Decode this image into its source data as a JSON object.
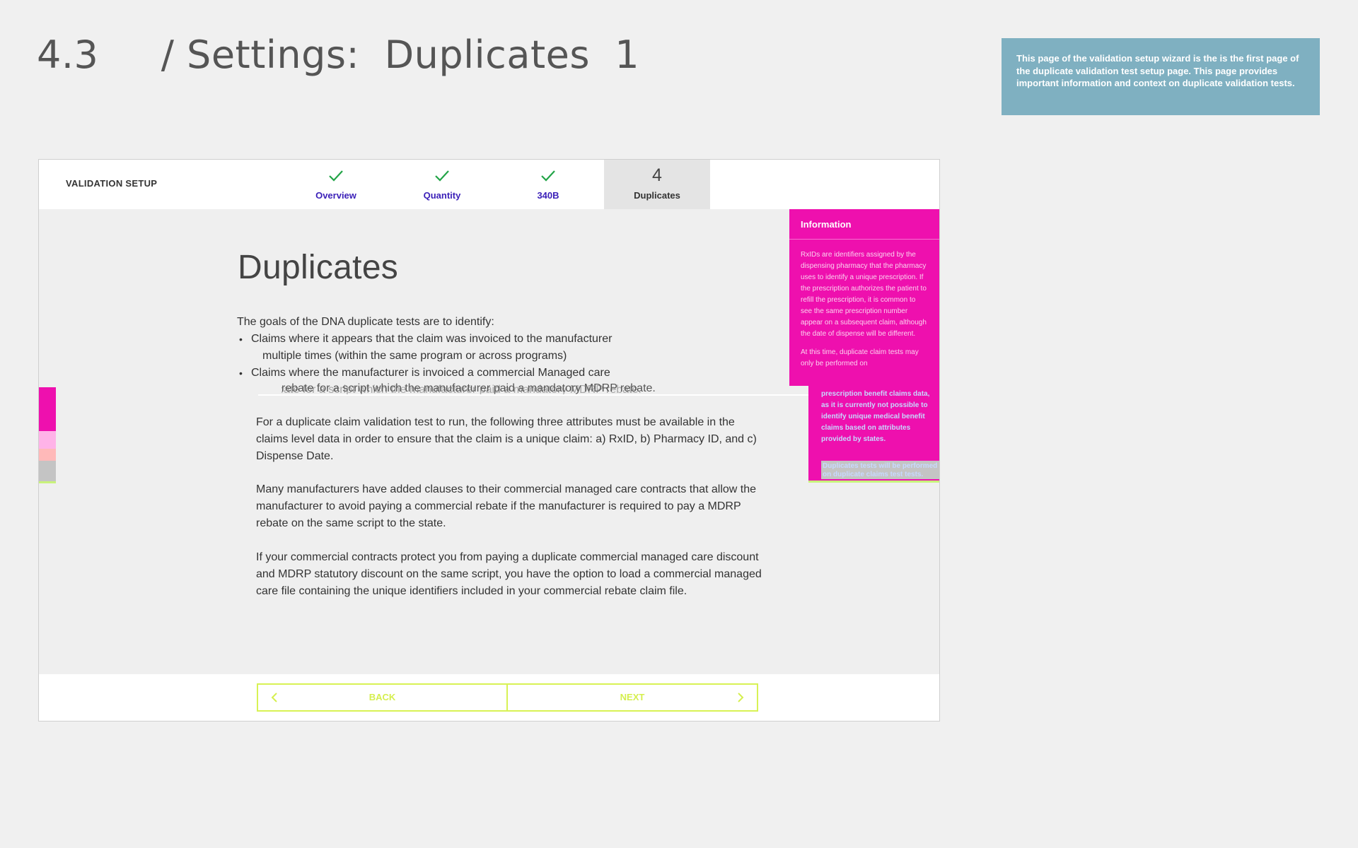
{
  "slide": {
    "title": "4.3     / Settings:  Duplicates  1",
    "note": "This page of the validation setup wizard is the is the first page of the duplicate validation test setup page. This page provides important information and context on duplicate validation  tests."
  },
  "app": {
    "brand": "VALIDATION SETUP",
    "steps": [
      {
        "label": "Overview",
        "state": "done"
      },
      {
        "label": "Quantity",
        "state": "done"
      },
      {
        "label": "340B",
        "state": "done"
      },
      {
        "number": "4",
        "label": "Duplicates",
        "state": "active"
      }
    ],
    "check_color": "#22a447",
    "accent": "#3a1fb8"
  },
  "content": {
    "title": "Duplicates",
    "goals_intro": "The goals of the DNA duplicate tests are to identify:",
    "bullets": [
      {
        "line1": "Claims where it appears that the claim was invoiced to the manufacturer",
        "line2": "multiple times (within the same program or across programs)"
      },
      {
        "line1": "Claims where the manufacturer is invoiced a commercial Managed care",
        "line2": "rebate for a script which the manufacturer paid a mandatory MDRP rebate."
      }
    ],
    "paragraphs": [
      "For a duplicate claim validation test to run, the following three attributes must be available in the claims level data in order to ensure that the claim is a unique claim: a) RxID, b) Pharmacy ID, and c) Dispense Date.",
      "Many manufacturers have added clauses to their commercial managed care contracts that allow the manufacturer to avoid paying a commercial rebate if the manufacturer is required to pay a MDRP rebate on the same script to the state.",
      "If your commercial contracts protect you from paying a duplicate commercial managed care discount and MDRP statutory discount on the same script, you have the option to load a commercial managed care file containing the unique identifiers included in your commercial rebate claim file."
    ]
  },
  "info": {
    "title": "Information",
    "para1": "RxIDs are identifiers assigned by the dispensing pharmacy that the pharmacy uses to identify a unique prescription. If the prescription authorizes the patient to refill the prescription, it is common to see the same prescription number appear on a subsequent claim, although the date of dispense will be different.",
    "para2": "At this time, duplicate claim tests may only be performed on",
    "para3": "prescription benefit claims data, as it is currently not possible to identify unique medical benefit claims based on attributes provided by states.",
    "para4": "Duplicates tests will be performed on duplicate claims test tests."
  },
  "colors": {
    "info_bg": "#ee10ae",
    "button_border": "#d8f254",
    "note_bg": "#7fb0c1"
  },
  "footer": {
    "back_label": "BACK",
    "next_label": "NEXT"
  }
}
